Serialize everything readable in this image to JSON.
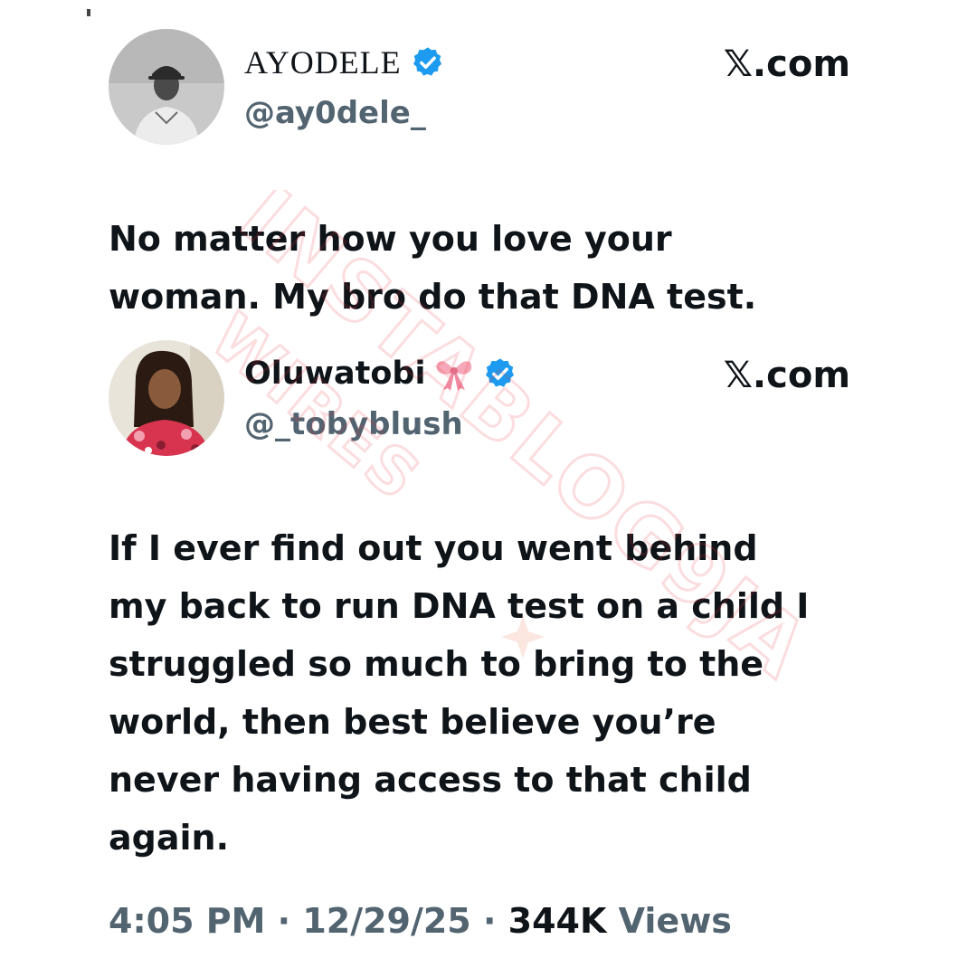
{
  "tweet1": {
    "display_name": "AYODELE",
    "handle": "@ay0dele_",
    "site": "𝕏.com",
    "text_lines": [
      "No matter how you love your",
      "woman. My bro do that DNA test."
    ]
  },
  "tweet2": {
    "display_name": "Oluwatobi",
    "emoji": "ribbon-bow",
    "handle": "@_tobyblush",
    "site": "𝕏.com",
    "text_lines": [
      "If I ever find out you went behind",
      "my back to run DNA test on a child I",
      "struggled so much to bring to the",
      "world, then best believe you’re",
      "never having access to that child",
      "again."
    ]
  },
  "meta": {
    "time": "4:05 PM",
    "sep1": " · ",
    "date": "12/29/25",
    "sep2": " · ",
    "views_count": "344K",
    "views_label": " Views"
  },
  "watermark": {
    "line1": "INSTABLOG9JA",
    "line2": "WIRES"
  },
  "colors": {
    "verified": "#1d9bf0",
    "text": "#0f1419",
    "muted": "#536471",
    "watermark": "#e8323c"
  }
}
